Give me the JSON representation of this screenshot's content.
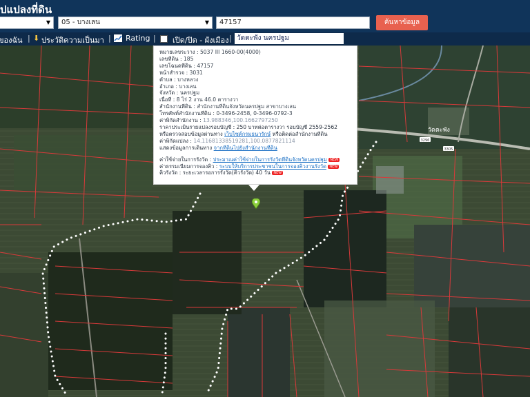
{
  "header": {
    "title": "ปแปลงที่ดิน",
    "province_value": "",
    "district_value": "05 - บางเลน",
    "parcel_value": "47157",
    "search_label": "ค้นหาข้อมูล"
  },
  "toolbar": {
    "item1": "ของฉัน",
    "sep": "|",
    "history_label": "ประวัติความเป็นมา",
    "rating_label": "Rating",
    "layer_toggle_label": "เปิด/ปิด - ผังเมือง",
    "search_owner_value": "วัดตะพัง นครปฐม"
  },
  "popup": {
    "rows": [
      {
        "label": "หมายเลขระวาง :",
        "value": "5037 III 1660-00(4000)"
      },
      {
        "label": "เลขที่ดิน :",
        "value": "185"
      },
      {
        "label": "เลขโฉนดที่ดิน :",
        "value": "47157"
      },
      {
        "label": "หน้าสำรวจ :",
        "value": "3031"
      },
      {
        "label": "ตำบล :",
        "value": "บางหลวง"
      },
      {
        "label": "อำเภอ :",
        "value": "บางเลน"
      },
      {
        "label": "จังหวัด :",
        "value": "นครปฐม"
      },
      {
        "label": "เนื้อที่ :",
        "value": "8 ไร่ 2 งาน 46.0 ตารางวา"
      },
      {
        "label": "สำนักงานที่ดิน :",
        "value": "สำนักงานที่ดินจังหวัดนครปฐม สาขาบางเลน"
      },
      {
        "label": "โทรศัพท์สำนักงานที่ดิน :",
        "value": "0-3496-2458, 0-3496-0792-3"
      }
    ],
    "office_coord_label": "ค่าพิกัดสำนักงาน :",
    "office_coord_value": "13.988346,100.1662797250",
    "price_row": "ราคาประเมินรายแปลงรอบบัญชี : 250 บาทต่อตารางวา รอบบัญชี 2559-2562",
    "check_prefix": "หรือตรวจสอบข้อมูลผ่านทาง",
    "check_link": "เว็บไซต์กรมธนารักษ์",
    "check_suffix": "หรือติดต่อสำนักงานที่ดิน",
    "parcel_coord_label": "ค่าพิกัดแปลง :",
    "parcel_coord_value": "14.11681338519281,100.0877821114",
    "route_prefix": "แสดงข้อมูลการเดินทาง",
    "route_link": "จากที่ดินไปยังสำนักงานที่ดิน",
    "fee_label": "ค่าใช้จ่ายในการรังวัด :",
    "fee_link": "ประมาณค่าใช้จ่ายในการรังวัดที่ดินจังหวัดนครปฐม",
    "queue_label": "ค่าธรรมเนียมการจองคิว :",
    "queue_link": "ระบบให้บริการประชาชนในการจองคิวงานรังวัด",
    "survey_label": "คิวรังวัด :",
    "survey_value": "ระยะเวลารอการรังวัด(คิวรังวัด) 40 วัน",
    "badge": "NEW"
  },
  "map": {
    "road_labels": [
      "3305",
      "3296"
    ],
    "place_label": "วัดตะพัง"
  },
  "colors": {
    "header_bg": "#10345a",
    "toolbar_bg": "#0e2a4a",
    "search_button": "#e8614f",
    "parcel_line": "#d93a3a",
    "boundary_dots": "#ffffff",
    "pin": "#8ccf3c"
  }
}
